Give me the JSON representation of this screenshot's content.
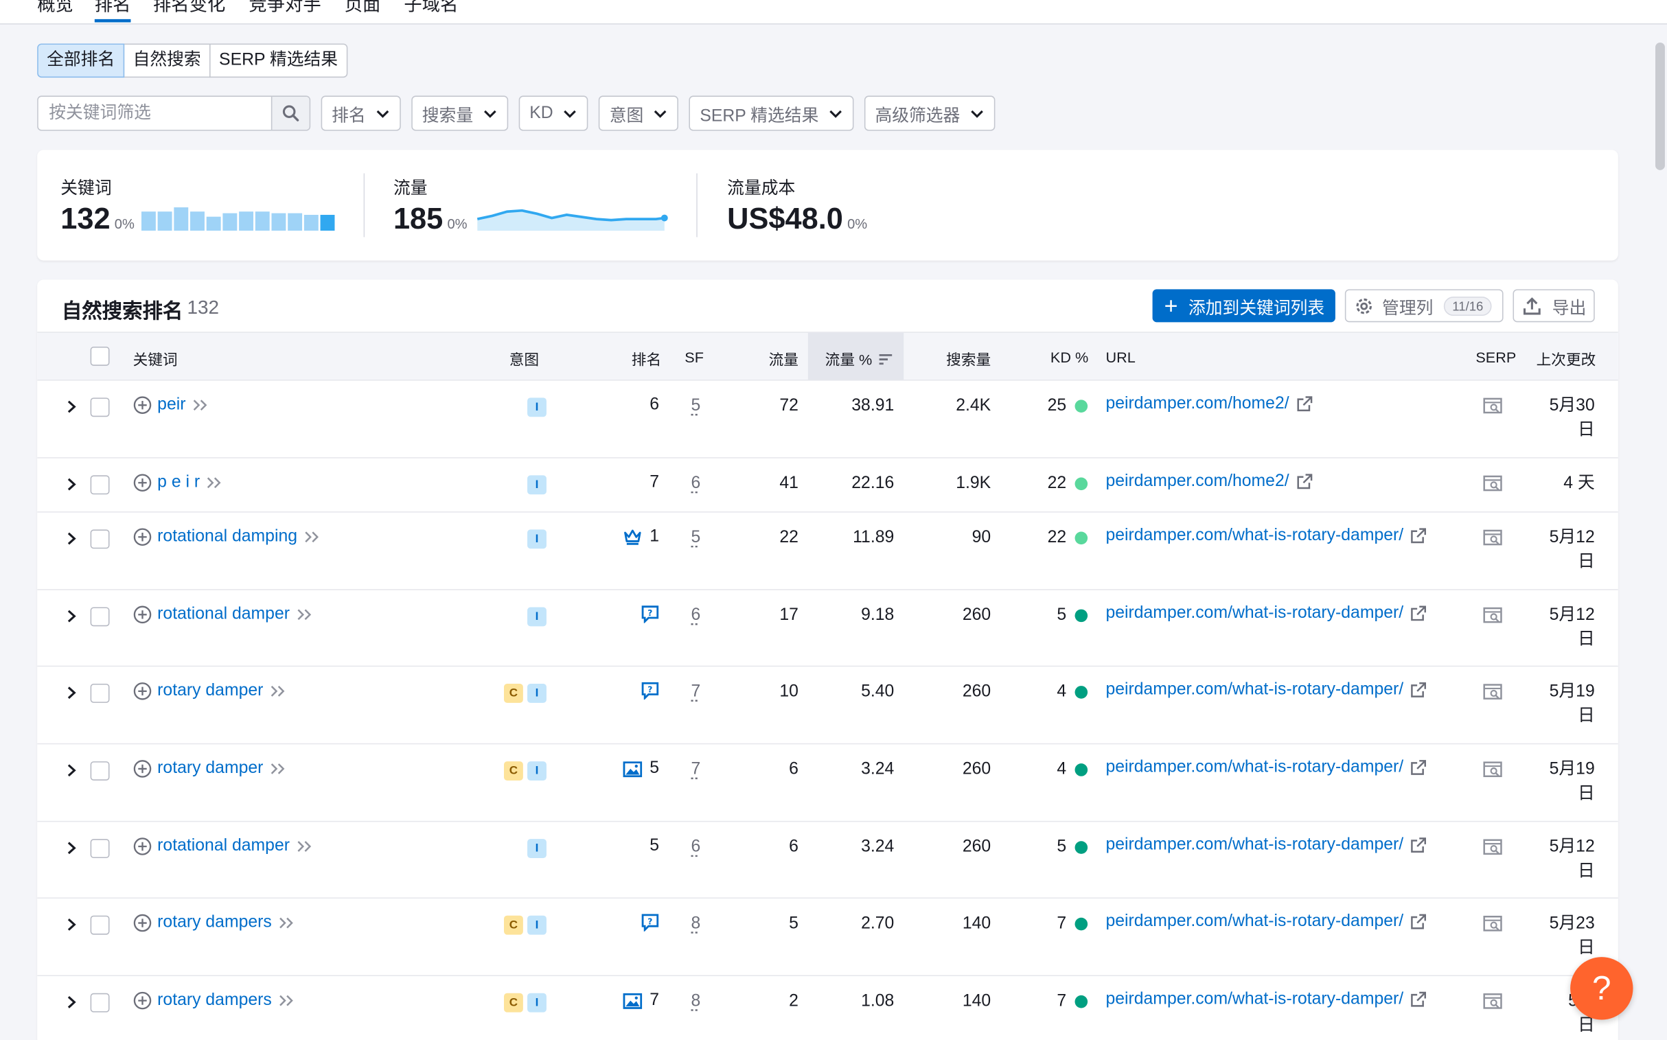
{
  "topnav": {
    "tabs": [
      "概览",
      "排名",
      "排名变化",
      "竞争对手",
      "页面",
      "子域名"
    ],
    "active": 1
  },
  "segments": [
    "全部排名",
    "自然搜索",
    "SERP 精选结果"
  ],
  "filters": {
    "search_placeholder": "按关键词筛选",
    "buttons": [
      "排名",
      "搜索量",
      "KD",
      "意图",
      "SERP 精选结果",
      "高级筛选器"
    ]
  },
  "summary": {
    "keywords": {
      "label": "关键词",
      "value": "132",
      "pct": "0%",
      "bars": [
        0.82,
        0.82,
        1.0,
        0.82,
        0.6,
        0.75,
        0.82,
        0.82,
        0.75,
        0.75,
        0.68,
        0.68
      ]
    },
    "traffic": {
      "label": "流量",
      "value": "185",
      "pct": "0%"
    },
    "cost": {
      "label": "流量成本",
      "value": "US$48.0",
      "pct": "0%"
    }
  },
  "table": {
    "title": "自然搜索排名",
    "count": "132",
    "add_button": "添加到关键词列表",
    "manage_button": "管理列",
    "manage_badge": "11/16",
    "export_button": "导出",
    "headers": {
      "keyword": "关键词",
      "intent": "意图",
      "position": "排名",
      "sf": "SF",
      "traffic": "流量",
      "traffic_pct": "流量 %",
      "volume": "搜索量",
      "kd": "KD %",
      "url": "URL",
      "serp": "SERP",
      "updated": "上次更改"
    },
    "rows": [
      {
        "keyword": "peir",
        "intent": [
          "I"
        ],
        "pos_icon": "",
        "position": "6",
        "sf": "5",
        "traffic": "72",
        "traffic_pct": "38.91",
        "volume": "2.4K",
        "kd": "25",
        "kd_color": "#59d89c",
        "url": "peirdamper.com/home2/",
        "date1": "5月30",
        "date2": "日"
      },
      {
        "keyword": "p e i r",
        "intent": [
          "I"
        ],
        "pos_icon": "",
        "position": "7",
        "sf": "6",
        "traffic": "41",
        "traffic_pct": "22.16",
        "volume": "1.9K",
        "kd": "22",
        "kd_color": "#59d89c",
        "url": "peirdamper.com/home2/",
        "date1": "4 天",
        "date2": ""
      },
      {
        "keyword": "rotational damping",
        "intent": [
          "I"
        ],
        "pos_icon": "crown",
        "position": "1",
        "sf": "5",
        "traffic": "22",
        "traffic_pct": "11.89",
        "volume": "90",
        "kd": "22",
        "kd_color": "#59d89c",
        "url": "peirdamper.com/what-is-rotary-damper/",
        "date1": "5月12",
        "date2": "日"
      },
      {
        "keyword": "rotational damper",
        "intent": [
          "I"
        ],
        "pos_icon": "faq",
        "position": "",
        "sf": "6",
        "traffic": "17",
        "traffic_pct": "9.18",
        "volume": "260",
        "kd": "5",
        "kd_color": "#009f81",
        "url": "peirdamper.com/what-is-rotary-damper/",
        "date1": "5月12",
        "date2": "日"
      },
      {
        "keyword": "rotary damper",
        "intent": [
          "C",
          "I"
        ],
        "pos_icon": "faq",
        "position": "",
        "sf": "7",
        "traffic": "10",
        "traffic_pct": "5.40",
        "volume": "260",
        "kd": "4",
        "kd_color": "#009f81",
        "url": "peirdamper.com/what-is-rotary-damper/",
        "date1": "5月19",
        "date2": "日"
      },
      {
        "keyword": "rotary damper",
        "intent": [
          "C",
          "I"
        ],
        "pos_icon": "image",
        "position": "5",
        "sf": "7",
        "traffic": "6",
        "traffic_pct": "3.24",
        "volume": "260",
        "kd": "4",
        "kd_color": "#009f81",
        "url": "peirdamper.com/what-is-rotary-damper/",
        "date1": "5月19",
        "date2": "日"
      },
      {
        "keyword": "rotational damper",
        "intent": [
          "I"
        ],
        "pos_icon": "",
        "position": "5",
        "sf": "6",
        "traffic": "6",
        "traffic_pct": "3.24",
        "volume": "260",
        "kd": "5",
        "kd_color": "#009f81",
        "url": "peirdamper.com/what-is-rotary-damper/",
        "date1": "5月12",
        "date2": "日"
      },
      {
        "keyword": "rotary dampers",
        "intent": [
          "C",
          "I"
        ],
        "pos_icon": "faq",
        "position": "",
        "sf": "8",
        "traffic": "5",
        "traffic_pct": "2.70",
        "volume": "140",
        "kd": "7",
        "kd_color": "#009f81",
        "url": "peirdamper.com/what-is-rotary-damper/",
        "date1": "5月23",
        "date2": "日"
      },
      {
        "keyword": "rotary dampers",
        "intent": [
          "C",
          "I"
        ],
        "pos_icon": "image",
        "position": "7",
        "sf": "8",
        "traffic": "2",
        "traffic_pct": "1.08",
        "volume": "140",
        "kd": "7",
        "kd_color": "#009f81",
        "url": "peirdamper.com/what-is-rotary-damper/",
        "date1": "5月",
        "date2": "日"
      }
    ]
  },
  "help_label": "?",
  "colors": {
    "accent": "#006dca",
    "help": "#ff642d",
    "kd_easy": "#59d89c",
    "kd_very_easy": "#009f81"
  }
}
